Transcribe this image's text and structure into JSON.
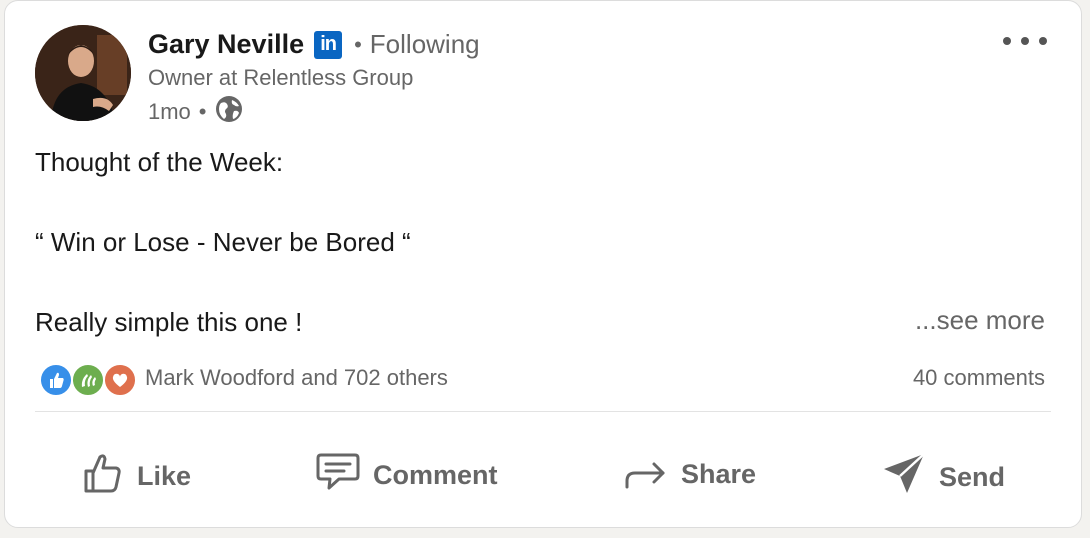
{
  "post": {
    "author_name": "Gary Neville",
    "linkedin_badge": "in",
    "separator": "•",
    "follow_status": "Following",
    "author_title": "Owner at Relentless Group",
    "time_ago": "1mo",
    "visibility_icon": "globe-icon",
    "body_lines": [
      "Thought of the Week:",
      "“ Win or Lose - Never be Bored “",
      "Really simple this one !"
    ],
    "see_more": "...see more"
  },
  "engagement": {
    "reaction_icons": [
      "like-reaction-icon",
      "celebrate-reaction-icon",
      "love-reaction-icon"
    ],
    "reactions_text": "Mark Woodford and 702 others",
    "comments_text": "40 comments"
  },
  "actions": {
    "like": "Like",
    "comment": "Comment",
    "share": "Share",
    "send": "Send"
  },
  "colors": {
    "linkedin_blue": "#0a66c2",
    "muted_text": "#666666",
    "like_blue": "#378fe9",
    "celebrate_green": "#6dae4f",
    "love_red": "#df704d"
  }
}
